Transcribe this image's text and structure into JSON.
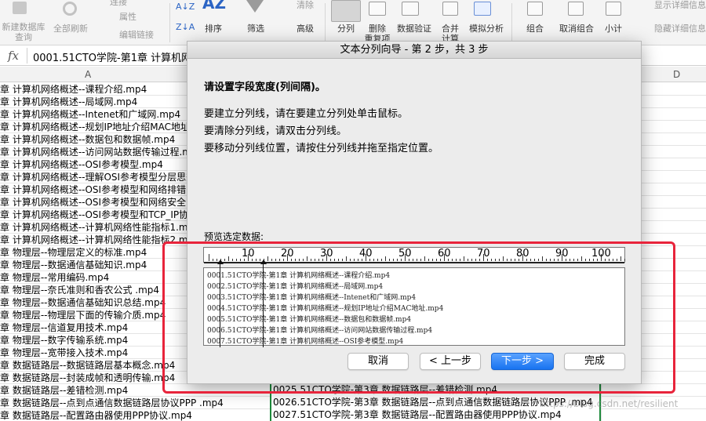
{
  "ribbon": {
    "new_db_query": "新建数据库\n查询",
    "refresh_all": "全部刷新",
    "connections": "连接",
    "properties": "属性",
    "edit_links": "编辑链接",
    "sort": "排序",
    "filter": "筛选",
    "clear": "清除",
    "advanced": "高级",
    "text_to_columns": "分列",
    "remove_duplicates": "删除\n重复项",
    "data_validation": "数据验证",
    "consolidate": "合并\n计算",
    "what_if": "模拟分析",
    "group": "组合",
    "ungroup": "取消组合",
    "subtotal": "小计",
    "show_detail": "显示详细信息",
    "hide_detail": "隐藏详细信息"
  },
  "formula_bar": {
    "fx": "fx",
    "value": "0001.51CTO学院-第1章 计算机网"
  },
  "columns": [
    "A",
    "D"
  ],
  "colA_rows": [
    "章 计算机网络概述--课程介绍.mp4",
    "章 计算机网络概述--局域网.mp4",
    "章 计算机网络概述--Intenet和广域网.mp4",
    "章 计算机网络概述--规划IP地址介绍MAC地址.",
    "章 计算机网络概述--数据包和数据帧.mp4",
    "章 计算机网络概述--访问网站数据传输过程.mp",
    "章 计算机网络概述--OSI参考模型.mp4",
    "章 计算机网络概述--理解OSI参考模型分层思想",
    "章 计算机网络概述--OSI参考模型和网络排错.m",
    "章 计算机网络概述--OSI参考模型和网络安全.m",
    "章 计算机网络概述--OSI参考模型和TCP_IP协议",
    "章 计算机网络概述--计算机网络性能指标1.mp",
    "章 计算机网络概述--计算机网络性能指标2.mp4",
    "章 物理层--物理层定义的标准.mp4",
    "章 物理层--数据通信基础知识.mp4",
    "章 物理层--常用编码.mp4",
    "章 物理层--奈氏准则和香农公式 .mp4",
    "章 物理层--数据通信基础知识总结.mp4",
    "章 物理层--物理层下面的传输介质.mp4",
    "章 物理层--信道复用技术.mp4",
    "章 物理层--数字传输系统.mp4",
    "章 物理层--宽带接入技术.mp4",
    "章 数据链路层--数据链路层基本概念.mp4",
    "章 数据链路层--封装成帧和透明传输.mp4",
    "章 数据链路层--差错检测.mp4",
    "章 数据链路层--点到点通信数据链路层协议PPP .mp4",
    "章 数据链路层--配置路由器使用PPP协议.mp4"
  ],
  "colB_rows": [
    "0025.51CTO学院-第3章 数据链路层--差错检测.mp4",
    "0026.51CTO学院-第3章 数据链路层--点到点通信数据链路层协议PPP .mp4",
    "0027.51CTO学院-第3章 数据链路层--配置路由器使用PPP协议.mp4"
  ],
  "dialog": {
    "title": "文本分列向导 - 第 2 步，共 3 步",
    "heading": "请设置字段宽度(列间隔)。",
    "instr1": "要建立分列线，请在要建立分列处单击鼠标。",
    "instr2": "要清除分列线，请双击分列线。",
    "instr3": "要移动分列线位置，请按住分列线并拖至指定位置。",
    "preview_label": "预览选定数据:",
    "ruler_labels": [
      "10",
      "20",
      "30",
      "40",
      "50",
      "60",
      "70",
      "80",
      "90",
      "100"
    ],
    "preview_lines": [
      "0001.51CTO学院-第1章 计算机网络概述--课程介绍.mp4",
      "0002.51CTO学院-第1章 计算机网络概述--局域网.mp4",
      "0003.51CTO学院-第1章 计算机网络概述--Intenet和广域网.mp4",
      "0004.51CTO学院-第1章 计算机网络概述--规划IP地址介绍MAC地址.mp4",
      "0005.51CTO学院-第1章 计算机网络概述--数据包和数据帧.mp4",
      "0006.51CTO学院-第1章 计算机网络概述--访问网站数据传输过程.mp4",
      "0007.51CTO学院-第1章 计算机网络概述--OSI参考模型.mp4"
    ],
    "buttons": {
      "cancel": "取消",
      "back": "< 上一步",
      "next": "下一步 >",
      "finish": "完成"
    }
  },
  "watermark": "https://blog.csdn.net/resilient"
}
